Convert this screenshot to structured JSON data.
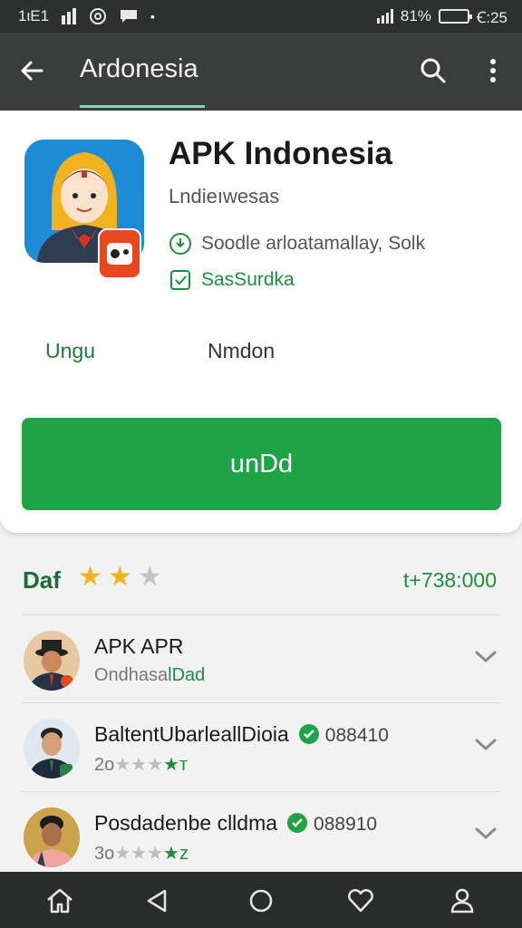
{
  "status_bar": {
    "left_text": "1ιE1",
    "battery_percent": "81%",
    "time": "Ꞓ:25",
    "battery_level": 0.81
  },
  "app_bar": {
    "title": "Ardonesia"
  },
  "app": {
    "name": "APK Indonesia",
    "developer": "Lndieıwesas",
    "meta_1": "Soodle arloatamallay, Solk",
    "meta_2": "SasSurdka",
    "tab_1": "Ungu",
    "tab_2": "Nmdon",
    "install_label": "unDd"
  },
  "rating": {
    "label": "Daf",
    "stars": [
      1,
      1,
      0
    ],
    "count": "t+738:000"
  },
  "list": [
    {
      "title": "APK APR",
      "sub_gray": "Ondhasa",
      "sub_green": "lDad"
    },
    {
      "title": "BaltentUbarleallDioia",
      "number": "088410",
      "stars_prefix": "2o",
      "stars_gray": "★★★",
      "stars_green": "★ᴛ"
    },
    {
      "title": "Posdadenbe clldma",
      "number": "088910",
      "stars_prefix": "3o",
      "stars_gray": "★★★",
      "stars_green": "★ᴢ"
    }
  ],
  "colors": {
    "accent_green": "#1ea446",
    "toolbar": "#3a3d3c",
    "status_bar": "#2d302f",
    "star_yellow": "#f3b21a"
  },
  "icons": {
    "back": "arrow-left-icon",
    "search": "search-icon",
    "more": "more-vert-icon",
    "download": "download-circle-icon",
    "verified": "verified-check-icon",
    "chevron": "chevron-down-icon",
    "nav": [
      "home-icon",
      "back-triangle-icon",
      "home-circle-icon",
      "heart-icon",
      "person-icon"
    ]
  }
}
